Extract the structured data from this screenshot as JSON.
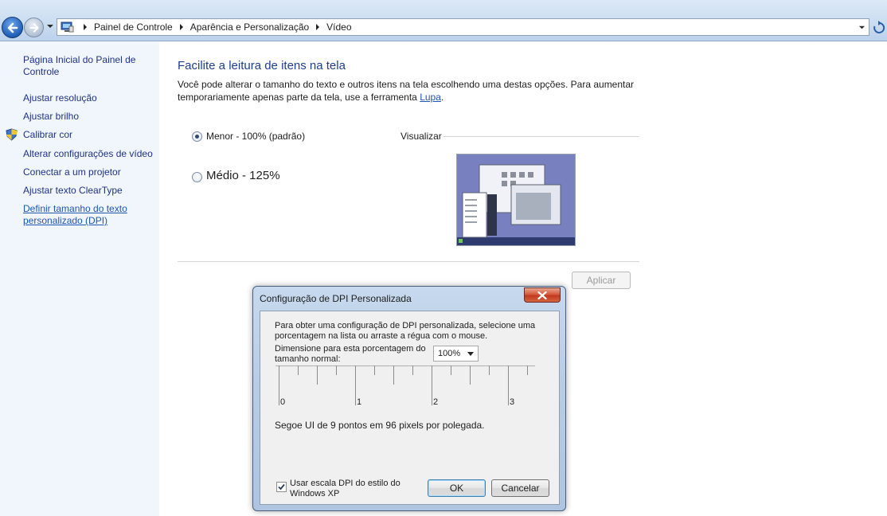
{
  "address_bar": {
    "breadcrumbs": [
      "Painel de Controle",
      "Aparência e Personalização",
      "Vídeo"
    ]
  },
  "sidebar": {
    "home_link": "Página Inicial do Painel de Controle",
    "links": [
      "Ajustar resolução",
      "Ajustar brilho",
      "Calibrar cor",
      "Alterar configurações de vídeo",
      "Conectar a um projetor",
      "Ajustar texto ClearType"
    ],
    "custom_dpi_link": "Definir tamanho do texto personalizado (DPI)"
  },
  "main": {
    "title": "Facilite a leitura de itens na tela",
    "description": "Você pode alterar o tamanho do texto e outros itens na tela escolhendo uma destas opções. Para aumentar temporariamente apenas parte da tela, use a ferramenta",
    "description_link": "Lupa",
    "description_end": ".",
    "options": [
      {
        "label": "Menor - 100% (padrão)",
        "selected": true
      },
      {
        "label": "Médio - 125%",
        "selected": false
      }
    ],
    "preview_label": "Visualizar",
    "apply_button": "Aplicar"
  },
  "dialog": {
    "title": "Configuração de DPI Personalizada",
    "instructions": "Para obter uma configuração de DPI personalizada, selecione uma porcentagem na lista ou arraste a régua com o mouse.",
    "scale_label": "Dimensione para esta porcentagem do tamanho normal:",
    "scale_value": "100%",
    "ruler_labels": [
      "0",
      "1",
      "2",
      "3"
    ],
    "font_info": "Segoe UI de 9 pontos em 96 pixels por polegada.",
    "xp_checkbox_label": "Usar escala DPI do estilo do Windows XP",
    "xp_checkbox_checked": true,
    "ok_button": "OK",
    "cancel_button": "Cancelar"
  },
  "icons": {
    "back": "back-arrow-icon",
    "forward": "forward-arrow-icon",
    "control_panel": "control-panel-icon",
    "shield": "uac-shield-icon",
    "close": "close-icon",
    "refresh": "refresh-icon"
  }
}
